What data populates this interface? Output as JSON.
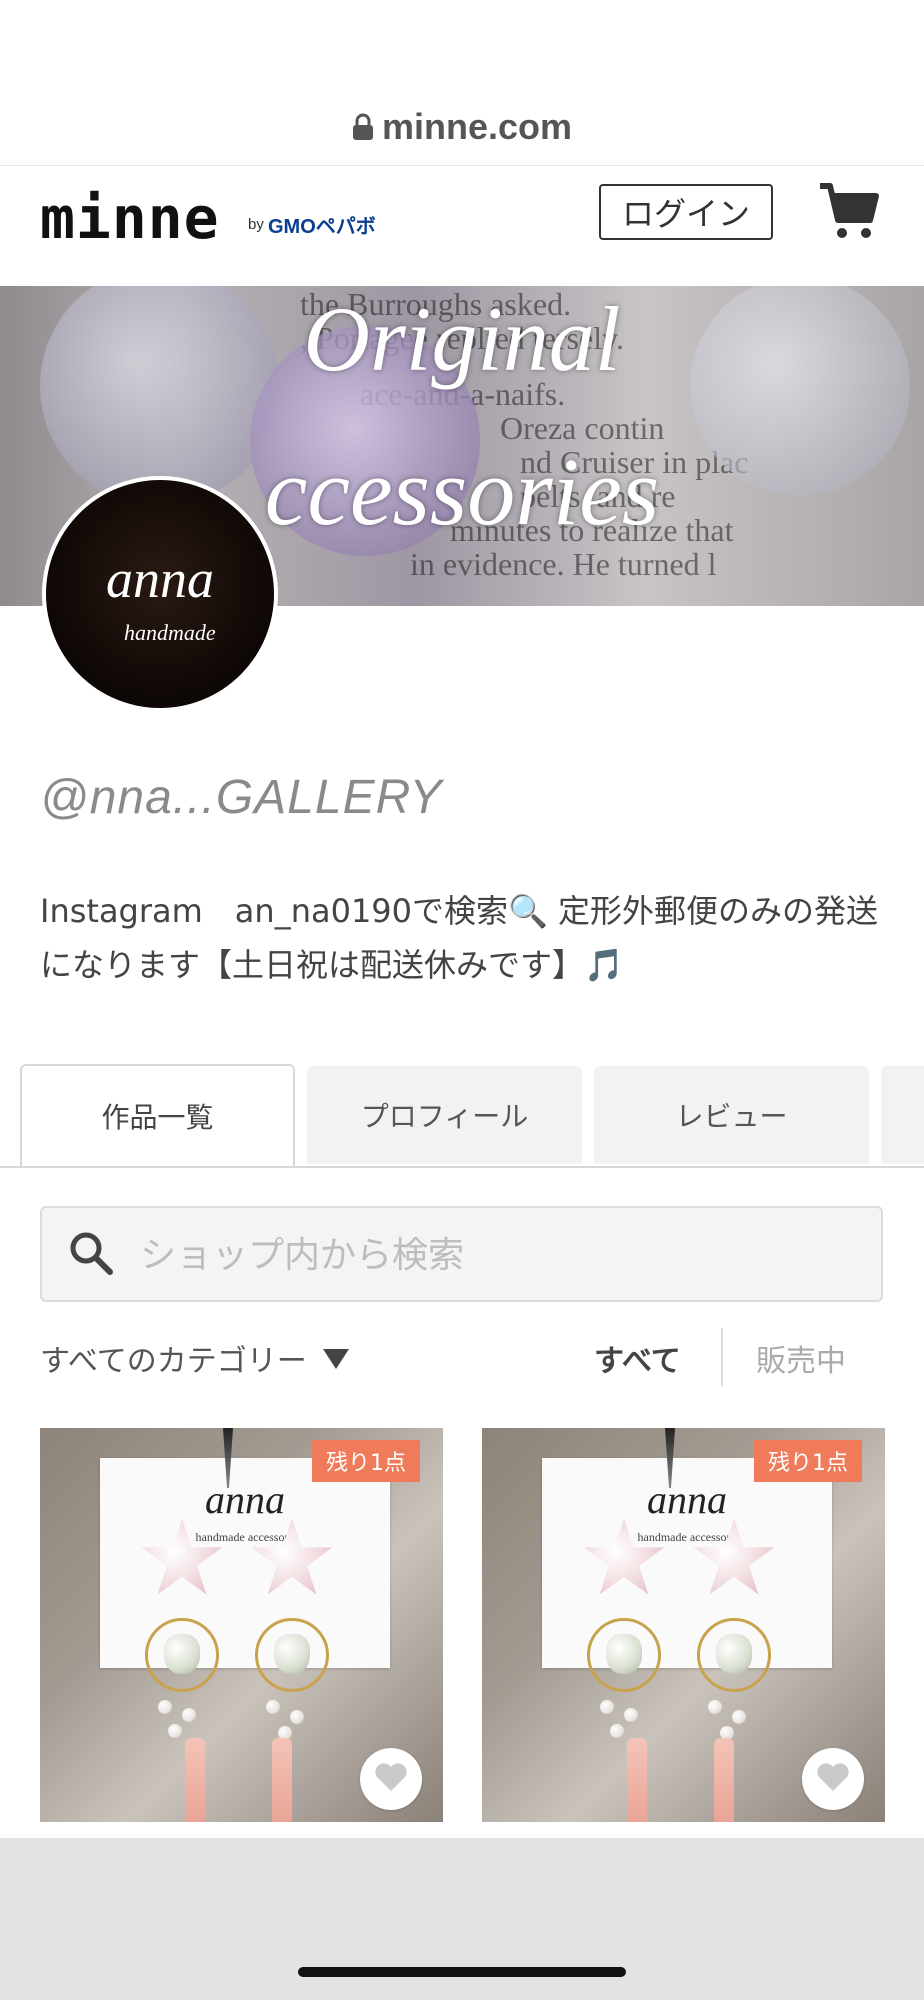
{
  "browser": {
    "url": "minne.com"
  },
  "header": {
    "logo": "minne",
    "logo_by": "by",
    "logo_company": "GMOペパボ",
    "login_label": "ログイン"
  },
  "banner": {
    "title_line1": "Original",
    "title_line2": "ccessories",
    "paper_lines": [
      "the   Burroughs asked.",
      ", Portagee replied tersely.",
      "ace-and-a-naifs.   ",
      "Oreza contin",
      "nd Cruiser in plac",
      "pelts, and re",
      "minutes to realize that",
      "in evidence. He turned l"
    ]
  },
  "avatar": {
    "text": "anna",
    "subtext": "handmade"
  },
  "shop": {
    "name": "@nna...GALLERY",
    "description": "Instagram　an_na0190で検索🔍 定形外郵便のみの発送になります【土日祝は配送休みです】🎵"
  },
  "tabs": [
    {
      "label": "作品一覧",
      "active": true
    },
    {
      "label": "プロフィール",
      "active": false
    },
    {
      "label": "レビュー",
      "active": false
    }
  ],
  "search": {
    "placeholder": "ショップ内から検索",
    "value": ""
  },
  "filters": {
    "category": "すべてのカテゴリー",
    "all": "すべて",
    "on_sale": "販売中"
  },
  "products": [
    {
      "badge": "残り1点",
      "brand": "anna",
      "subtitle": "handmade accessory"
    },
    {
      "badge": "残り1点",
      "brand": "anna",
      "subtitle": "handmade accessory"
    }
  ],
  "colors": {
    "badge": "#f07b5a",
    "accent": "#0b3d91"
  }
}
